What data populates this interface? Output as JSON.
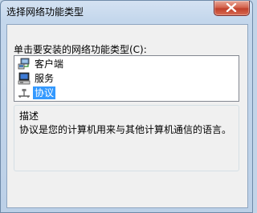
{
  "window": {
    "title": "选择网络功能类型"
  },
  "prompt": "单击要安装的网络功能类型(C):",
  "list": {
    "items": [
      {
        "label": "客户端",
        "icon": "client-icon"
      },
      {
        "label": "服务",
        "icon": "service-icon"
      },
      {
        "label": "协议",
        "icon": "protocol-icon",
        "selected": true
      }
    ]
  },
  "description": {
    "title": "描述",
    "text": "协议是您的计算机用来与其他计算机通信的语言。"
  },
  "colors": {
    "selection": "#3399ff",
    "close_button": "#c0402b"
  }
}
